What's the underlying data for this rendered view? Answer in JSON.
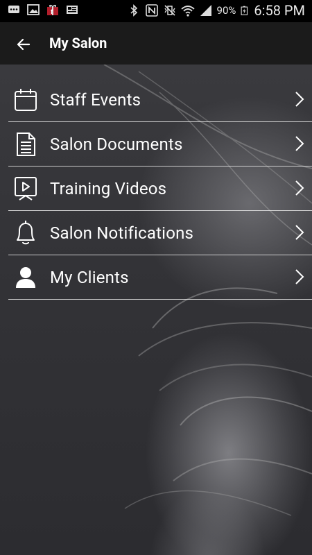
{
  "status_bar": {
    "battery_percent": "90%",
    "time": "6:58 PM",
    "icons": [
      "message-icon",
      "image-icon",
      "gift-app-icon",
      "news-icon",
      "bluetooth-icon",
      "nfc-icon",
      "vibrate-mute-icon",
      "wifi-icon",
      "signal-icon",
      "battery-charging-icon"
    ]
  },
  "app_bar": {
    "title": "My Salon",
    "back_icon": "arrow-left-icon"
  },
  "menu": {
    "items": [
      {
        "label": "Staff Events",
        "icon": "calendar-icon"
      },
      {
        "label": "Salon Documents",
        "icon": "document-icon"
      },
      {
        "label": "Training Videos",
        "icon": "video-play-icon"
      },
      {
        "label": "Salon Notifications",
        "icon": "bell-icon"
      },
      {
        "label": "My Clients",
        "icon": "person-icon"
      }
    ]
  },
  "colors": {
    "status_bar_bg": "#000000",
    "app_bar_bg": "#1b1b1b",
    "text": "#ffffff",
    "divider": "#e6e6e6"
  }
}
